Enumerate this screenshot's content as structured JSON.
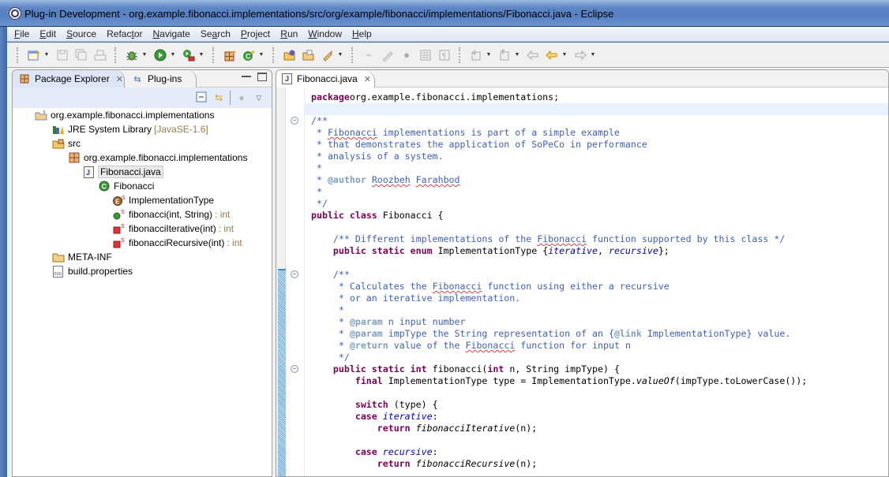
{
  "window": {
    "title": "Plug-in Development - org.example.fibonacci.implementations/src/org/example/fibonacci/implementations/Fibonacci.java - Eclipse"
  },
  "menu": [
    "File",
    "Edit",
    "Source",
    "Refactor",
    "Navigate",
    "Search",
    "Project",
    "Run",
    "Window",
    "Help"
  ],
  "menu_mnemonics": [
    "F",
    "E",
    "S",
    "t",
    "N",
    "a",
    "P",
    "R",
    "W",
    "H"
  ],
  "toolbar": {
    "groups": [
      [
        "new-wizard-icon",
        "save-icon",
        "save-all-icon",
        "print-icon"
      ],
      [
        "debug-icon",
        "run-icon",
        "external-tools-icon"
      ],
      [
        "new-package-icon",
        "new-class-icon"
      ],
      [
        "open-type-icon",
        "open-resource-icon",
        "search-icon"
      ],
      [
        "toggle-ant-icon",
        "toggle-mark-occurrences-icon",
        "toggle-breadcrumb-icon",
        "show-block-icon",
        "show-whitespace-icon"
      ],
      [
        "next-annotation-icon",
        "previous-annotation-icon",
        "last-edit-location-icon",
        "back-icon",
        "forward-icon"
      ]
    ]
  },
  "left_view": {
    "tabs": [
      {
        "label": "Package Explorer",
        "icon": "package-explorer-icon",
        "active": true
      },
      {
        "label": "Plug-ins",
        "icon": "plugins-icon",
        "active": false
      }
    ],
    "tree": [
      {
        "label": "org.example.fibonacci.implementations",
        "icon": "project-icon",
        "depth": 0
      },
      {
        "label": "JRE System Library",
        "decoration": "[JavaSE-1.6]",
        "icon": "library-icon",
        "depth": 1
      },
      {
        "label": "src",
        "icon": "source-folder-icon",
        "depth": 1
      },
      {
        "label": "org.example.fibonacci.implementations",
        "icon": "package-icon",
        "depth": 2
      },
      {
        "label": "Fibonacci.java",
        "icon": "java-file-icon",
        "depth": 3,
        "selected": true
      },
      {
        "label": "Fibonacci",
        "icon": "class-icon",
        "depth": 4
      },
      {
        "label": "ImplementationType",
        "icon": "enum-icon",
        "depth": 5
      },
      {
        "label": "fibonacci(int, String)",
        "decoration": ": int",
        "icon": "public-static-method-icon",
        "depth": 5
      },
      {
        "label": "fibonacciIterative(int)",
        "decoration": ": int",
        "icon": "private-static-method-icon",
        "depth": 5
      },
      {
        "label": "fibonacciRecursive(int)",
        "decoration": ": int",
        "icon": "private-static-method-icon",
        "depth": 5
      },
      {
        "label": "META-INF",
        "icon": "folder-icon",
        "depth": 1
      },
      {
        "label": "build.properties",
        "icon": "properties-file-icon",
        "depth": 1
      }
    ]
  },
  "editor": {
    "tab": {
      "label": "Fibonacci.java"
    },
    "lines": [
      [
        [
          "kw",
          "package"
        ],
        [
          "",
          "org.example.fibonacci.implementations;"
        ]
      ],
      [],
      [
        [
          "cm",
          "/**"
        ]
      ],
      [
        [
          "cm",
          " * "
        ],
        [
          "cm sq",
          "Fibonacci"
        ],
        [
          "cm",
          " implementations is part of a simple example"
        ]
      ],
      [
        [
          "cm",
          " * that demonstrates the application of SoPeCo in performance"
        ]
      ],
      [
        [
          "cm",
          " * analysis of a system."
        ]
      ],
      [
        [
          "cm",
          " *"
        ]
      ],
      [
        [
          "cm",
          " * "
        ],
        [
          "tag",
          "@author"
        ],
        [
          "cm",
          " "
        ],
        [
          "cm sq",
          "Roozbeh"
        ],
        [
          "cm",
          " "
        ],
        [
          "cm sq",
          "Farahbod"
        ]
      ],
      [
        [
          "cm",
          " *"
        ]
      ],
      [
        [
          "cm",
          " */"
        ]
      ],
      [
        [
          "kw",
          "public"
        ],
        [
          "",
          " "
        ],
        [
          "kw",
          "class"
        ],
        [
          "",
          " Fibonacci {"
        ]
      ],
      [],
      [
        [
          "cm",
          "    /** Different implementations of the "
        ],
        [
          "cm sq",
          "Fibonacci"
        ],
        [
          "cm",
          " function supported by this class */"
        ]
      ],
      [
        [
          "",
          "    "
        ],
        [
          "kw",
          "public"
        ],
        [
          "",
          " "
        ],
        [
          "kw",
          "static"
        ],
        [
          "",
          " "
        ],
        [
          "kw",
          "enum"
        ],
        [
          "",
          " ImplementationType {"
        ],
        [
          "en",
          "iterative"
        ],
        [
          "",
          ", "
        ],
        [
          "en",
          "recursive"
        ],
        [
          "",
          "};"
        ]
      ],
      [],
      [
        [
          "cm",
          "    /**"
        ]
      ],
      [
        [
          "cm",
          "     * Calculates the "
        ],
        [
          "cm sq",
          "Fibonacci"
        ],
        [
          "cm",
          " function using either a recursive"
        ]
      ],
      [
        [
          "cm",
          "     * or an iterative implementation."
        ]
      ],
      [
        [
          "cm",
          "     *"
        ]
      ],
      [
        [
          "cm",
          "     * "
        ],
        [
          "tag",
          "@param"
        ],
        [
          "cm",
          " n input number"
        ]
      ],
      [
        [
          "cm",
          "     * "
        ],
        [
          "tag",
          "@param"
        ],
        [
          "cm",
          " impType the String representation of an {"
        ],
        [
          "tag",
          "@link"
        ],
        [
          "cm",
          " ImplementationType} value."
        ]
      ],
      [
        [
          "cm",
          "     * "
        ],
        [
          "tag",
          "@return"
        ],
        [
          "cm",
          " value of the "
        ],
        [
          "cm sq",
          "Fibonacci"
        ],
        [
          "cm",
          " function for input n"
        ]
      ],
      [
        [
          "cm",
          "     */"
        ]
      ],
      [
        [
          "",
          "    "
        ],
        [
          "kw",
          "public"
        ],
        [
          "",
          " "
        ],
        [
          "kw",
          "static"
        ],
        [
          "",
          " "
        ],
        [
          "kw",
          "int"
        ],
        [
          "",
          " fibonacci("
        ],
        [
          "kw",
          "int"
        ],
        [
          "",
          " n, String impType) {"
        ]
      ],
      [
        [
          "",
          "        "
        ],
        [
          "kw",
          "final"
        ],
        [
          "",
          " ImplementationType type = ImplementationType."
        ],
        [
          "it",
          "valueOf"
        ],
        [
          "",
          "(impType.toLowerCase());"
        ]
      ],
      [],
      [
        [
          "",
          "        "
        ],
        [
          "kw",
          "switch"
        ],
        [
          "",
          " (type) {"
        ]
      ],
      [
        [
          "",
          "        "
        ],
        [
          "kw",
          "case"
        ],
        [
          "",
          " "
        ],
        [
          "en",
          "iterative"
        ],
        [
          "",
          ":"
        ]
      ],
      [
        [
          "",
          "            "
        ],
        [
          "kw",
          "return"
        ],
        [
          "",
          " "
        ],
        [
          "it",
          "fibonacciIterative"
        ],
        [
          "",
          "(n);"
        ]
      ],
      [],
      [
        [
          "",
          "        "
        ],
        [
          "kw",
          "case"
        ],
        [
          "",
          " "
        ],
        [
          "en",
          "recursive"
        ],
        [
          "",
          ":"
        ]
      ],
      [
        [
          "",
          "            "
        ],
        [
          "kw",
          "return"
        ],
        [
          "",
          " "
        ],
        [
          "it",
          "fibonacciRecursive"
        ],
        [
          "",
          "(n);"
        ]
      ]
    ],
    "highlighted_line": 1,
    "fold_lines": [
      2,
      15,
      23
    ]
  }
}
